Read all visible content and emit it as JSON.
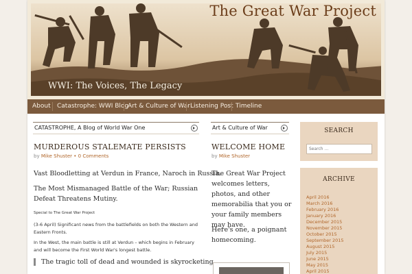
{
  "header": {
    "site_title": "The Great War Project",
    "tagline": "WWI: The Voices, The Legacy"
  },
  "nav": {
    "items": [
      {
        "label": "About"
      },
      {
        "label": "Catastrophe: WWI Blog"
      },
      {
        "label": "Art & Culture of War"
      },
      {
        "label": "Listening Post"
      },
      {
        "label": "Timeline"
      }
    ]
  },
  "left": {
    "widget_title": "CATASTROPHE, A Blog of World War One",
    "post_title": "MURDEROUS STALEMATE PERSISTS",
    "byline_prefix": "by",
    "author": "Mike Shuster",
    "separator": "•",
    "comments": "0 Comments",
    "lead1": "Vast Bloodletting at Verdun in France, Naroch in Russia.",
    "lead2": "The Most Mismanaged Battle of the War; Russian Defeat Threatens Mutiny.",
    "special": "Special to The Great War Project",
    "para1": "(3-6 April) Significant news from the battlefields on both the Western and Eastern Fronts.",
    "para2": "In the West, the main battle is still at Verdun – which begins in February and will become the First World War's longest battle.",
    "quote": "The tragic toll of dead and wounded is skyrocketing."
  },
  "middle": {
    "widget_title": "Art & Culture of War",
    "post_title": "WELCOME HOME",
    "byline_prefix": "by",
    "author": "Mike Shuster",
    "para1": "The Great War Project welcomes letters, photos, and other memorabilia that you or your family members may have.",
    "para2": "Here's one, a poignant homecoming."
  },
  "sidebar": {
    "search_title": "SEARCH",
    "search_placeholder": "Search ...",
    "archive_title": "ARCHIVE",
    "archive": [
      "April 2016",
      "March 2016",
      "February 2016",
      "January 2016",
      "December 2015",
      "November 2015",
      "October 2015",
      "September 2015",
      "August 2015",
      "July 2015",
      "June 2015",
      "May 2015",
      "April 2015"
    ]
  },
  "colors": {
    "nav_bg": "#7b5a3d",
    "link": "#b0662a",
    "sidebar_bg": "#ead6c0",
    "title_brown": "#6b3d1a"
  }
}
